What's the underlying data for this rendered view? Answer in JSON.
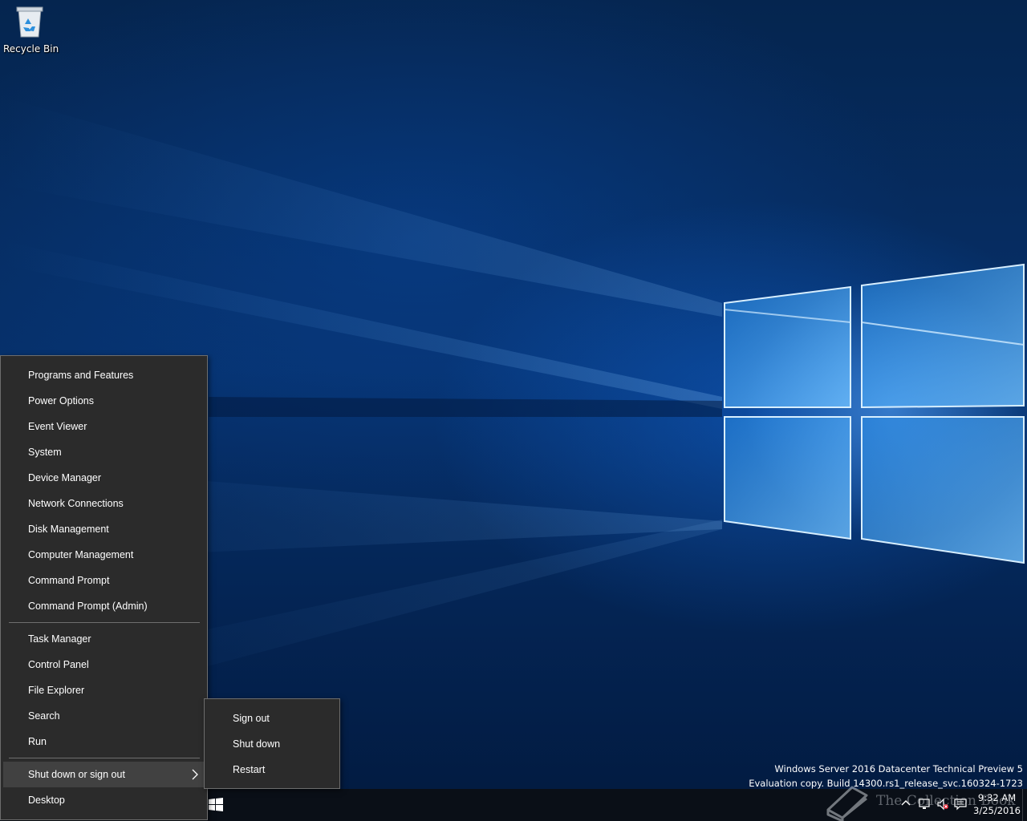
{
  "desktop": {
    "icons": [
      {
        "label": "Recycle Bin",
        "icon": "recycle-bin-icon"
      }
    ],
    "edition_line1": "Windows Server 2016 Datacenter Technical Preview 5",
    "edition_line2": "Evaluation copy. Build 14300.rs1_release_svc.160324-1723"
  },
  "context_menu": {
    "group1": [
      "Programs and Features",
      "Power Options",
      "Event Viewer",
      "System",
      "Device Manager",
      "Network Connections",
      "Disk Management",
      "Computer Management",
      "Command Prompt",
      "Command Prompt (Admin)"
    ],
    "group2": [
      "Task Manager",
      "Control Panel",
      "File Explorer",
      "Search",
      "Run"
    ],
    "group3": [
      "Shut down or sign out",
      "Desktop"
    ],
    "highlighted": "Shut down or sign out"
  },
  "submenu": {
    "items": [
      "Sign out",
      "Shut down",
      "Restart"
    ]
  },
  "taskbar": {
    "start_icon": "windows-logo-icon",
    "tray_icons": [
      "chevron-up-icon",
      "network-icon",
      "volume-muted-icon",
      "action-center-icon"
    ],
    "clock_time": "9:32 AM",
    "clock_date": "3/25/2016"
  },
  "watermark": {
    "text": "The Collection Book",
    "icon": "book-icon"
  },
  "colors": {
    "menu_bg": "#2b2b2b",
    "menu_highlight": "#414141",
    "taskbar_bg": "#0a0f17"
  }
}
